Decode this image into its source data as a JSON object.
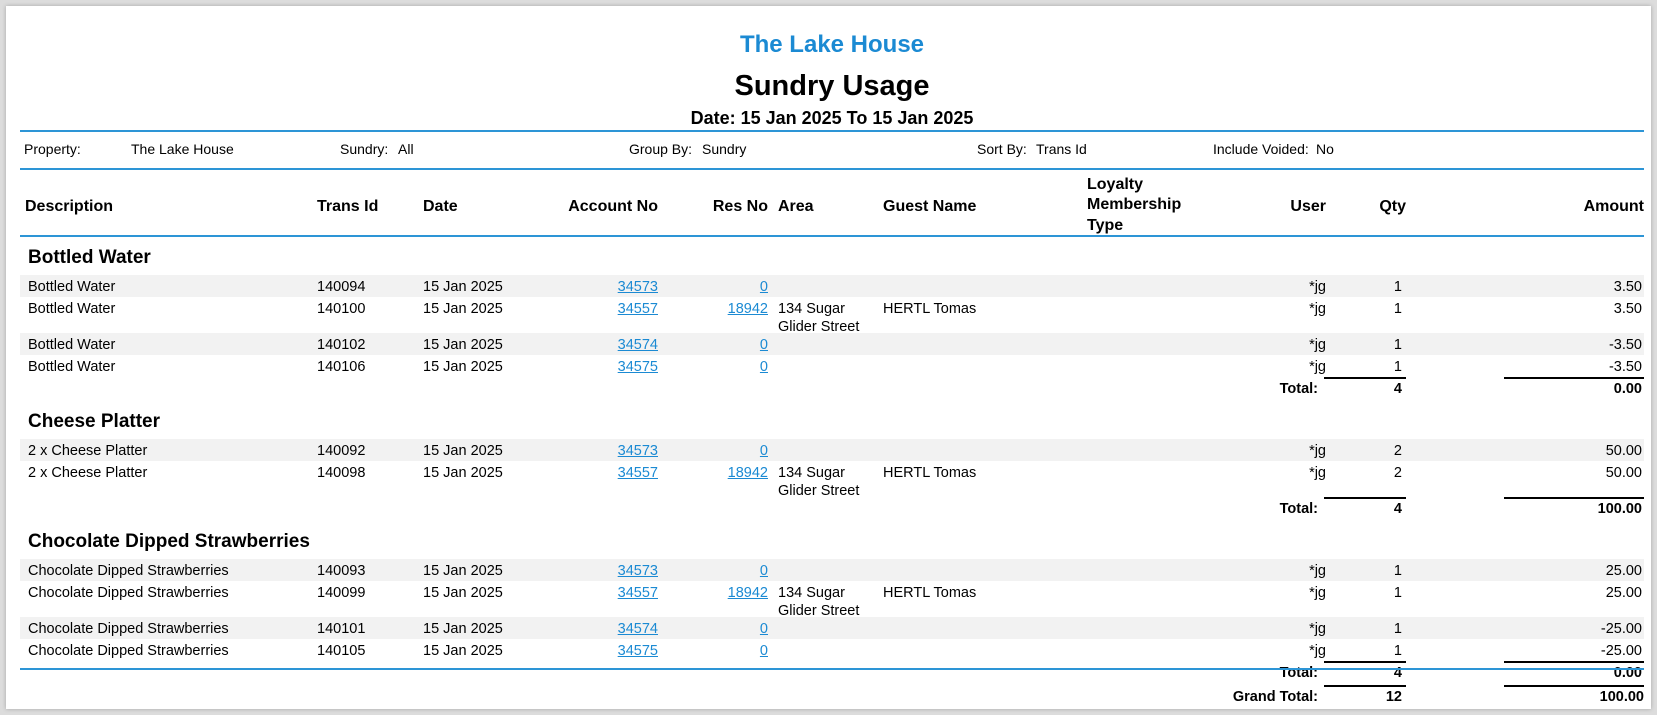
{
  "header": {
    "property_name": "The Lake House",
    "report_title": "Sundry Usage",
    "date_range": "Date: 15 Jan 2025 To 15 Jan 2025"
  },
  "filters": {
    "property_label": "Property:",
    "property_value": "The Lake House",
    "sundry_label": "Sundry:",
    "sundry_value": "All",
    "group_by_label": "Group By:",
    "group_by_value": "Sundry",
    "sort_by_label": "Sort By:",
    "sort_by_value": "Trans Id",
    "include_voided_label": "Include Voided:",
    "include_voided_value": "No"
  },
  "columns": {
    "description": "Description",
    "trans_id": "Trans Id",
    "date": "Date",
    "account_no": "Account No",
    "res_no": "Res No",
    "area": "Area",
    "guest_name": "Guest Name",
    "loyalty_line1": "Loyalty",
    "loyalty_line2": "Membership",
    "loyalty_line3": "Type",
    "user": "User",
    "qty": "Qty",
    "amount": "Amount"
  },
  "groups": [
    {
      "name": "Bottled Water",
      "rows": [
        {
          "description": "Bottled Water",
          "trans_id": "140094",
          "date": "15 Jan 2025",
          "account_no": "34573",
          "res_no": "0",
          "area": "",
          "area2": "",
          "guest": "",
          "user": "*jg",
          "qty": "1",
          "amount": "3.50"
        },
        {
          "description": "Bottled Water",
          "trans_id": "140100",
          "date": "15 Jan 2025",
          "account_no": "34557",
          "res_no": "18942",
          "area": "134 Sugar",
          "area2": "Glider Street",
          "guest": "HERTL Tomas",
          "user": "*jg",
          "qty": "1",
          "amount": "3.50"
        },
        {
          "description": "Bottled Water",
          "trans_id": "140102",
          "date": "15 Jan 2025",
          "account_no": "34574",
          "res_no": "0",
          "area": "",
          "area2": "",
          "guest": "",
          "user": "*jg",
          "qty": "1",
          "amount": "-3.50"
        },
        {
          "description": "Bottled Water",
          "trans_id": "140106",
          "date": "15 Jan 2025",
          "account_no": "34575",
          "res_no": "0",
          "area": "",
          "area2": "",
          "guest": "",
          "user": "*jg",
          "qty": "1",
          "amount": "-3.50"
        }
      ],
      "total_label": "Total:",
      "total_qty": "4",
      "total_amount": "0.00"
    },
    {
      "name": "Cheese Platter",
      "rows": [
        {
          "description": "2 x Cheese Platter",
          "trans_id": "140092",
          "date": "15 Jan 2025",
          "account_no": "34573",
          "res_no": "0",
          "area": "",
          "area2": "",
          "guest": "",
          "user": "*jg",
          "qty": "2",
          "amount": "50.00"
        },
        {
          "description": "2 x Cheese Platter",
          "trans_id": "140098",
          "date": "15 Jan 2025",
          "account_no": "34557",
          "res_no": "18942",
          "area": "134 Sugar",
          "area2": "Glider Street",
          "guest": "HERTL Tomas",
          "user": "*jg",
          "qty": "2",
          "amount": "50.00"
        }
      ],
      "total_label": "Total:",
      "total_qty": "4",
      "total_amount": "100.00"
    },
    {
      "name": "Chocolate Dipped Strawberries",
      "rows": [
        {
          "description": "Chocolate Dipped Strawberries",
          "trans_id": "140093",
          "date": "15 Jan 2025",
          "account_no": "34573",
          "res_no": "0",
          "area": "",
          "area2": "",
          "guest": "",
          "user": "*jg",
          "qty": "1",
          "amount": "25.00"
        },
        {
          "description": "Chocolate Dipped Strawberries",
          "trans_id": "140099",
          "date": "15 Jan 2025",
          "account_no": "34557",
          "res_no": "18942",
          "area": "134 Sugar",
          "area2": "Glider Street",
          "guest": "HERTL Tomas",
          "user": "*jg",
          "qty": "1",
          "amount": "25.00"
        },
        {
          "description": "Chocolate Dipped Strawberries",
          "trans_id": "140101",
          "date": "15 Jan 2025",
          "account_no": "34574",
          "res_no": "0",
          "area": "",
          "area2": "",
          "guest": "",
          "user": "*jg",
          "qty": "1",
          "amount": "-25.00"
        },
        {
          "description": "Chocolate Dipped Strawberries",
          "trans_id": "140105",
          "date": "15 Jan 2025",
          "account_no": "34575",
          "res_no": "0",
          "area": "",
          "area2": "",
          "guest": "",
          "user": "*jg",
          "qty": "1",
          "amount": "-25.00"
        }
      ],
      "total_label": "Total:",
      "total_qty": "4",
      "total_amount": "0.00"
    }
  ],
  "grand_total": {
    "label": "Grand Total:",
    "qty": "12",
    "amount": "100.00"
  }
}
